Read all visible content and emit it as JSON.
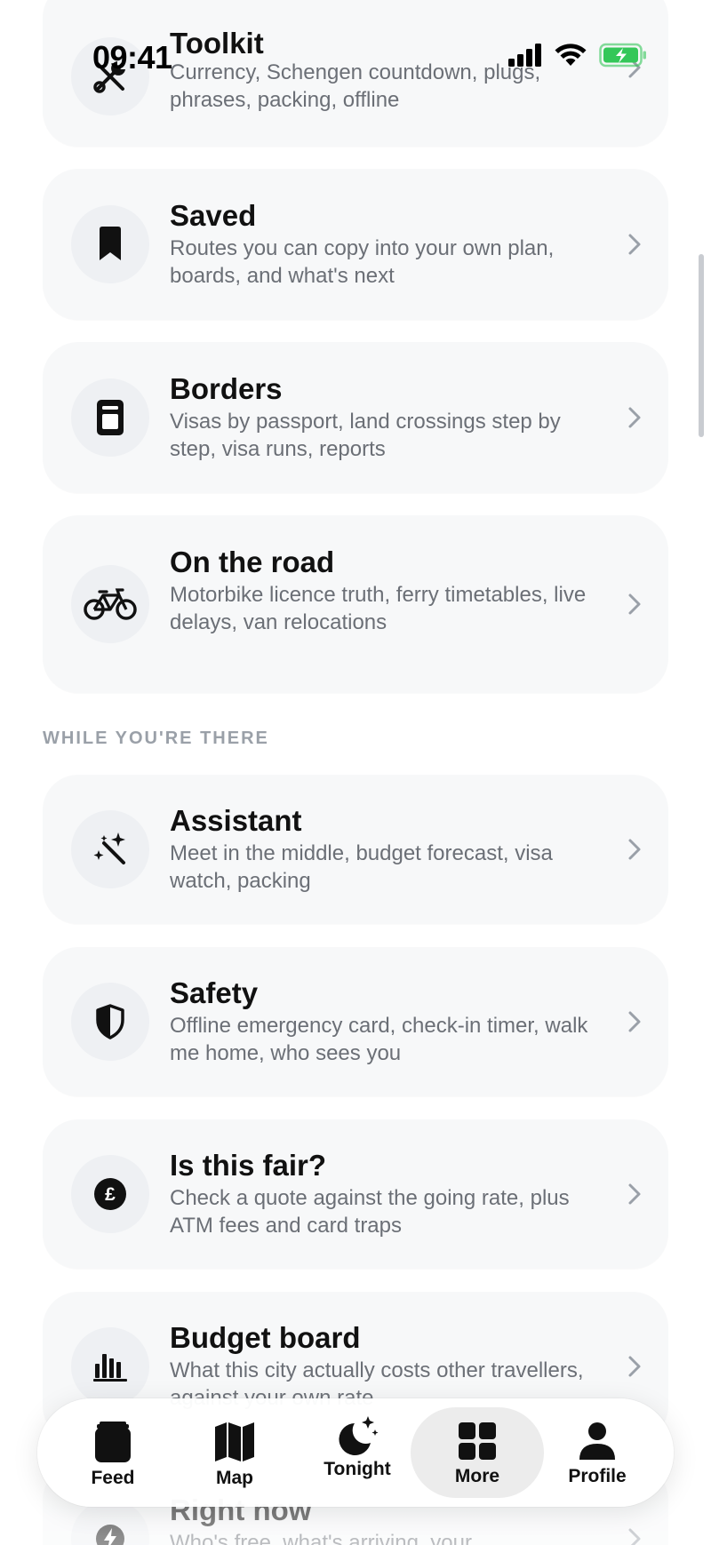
{
  "status_bar": {
    "time": "09:41",
    "signal_icon": "cellular-signal-icon",
    "wifi_icon": "wifi-icon",
    "battery_icon": "battery-charging-icon",
    "battery_color": "#34c759"
  },
  "cards_top": [
    {
      "title": "Toolkit",
      "desc": "Currency, Schengen countdown, plugs, phrases, packing, offline",
      "icon": "tools-icon"
    },
    {
      "title": "Saved",
      "desc": "Routes you can copy into your own plan, boards, and what's next",
      "icon": "bookmark-icon"
    },
    {
      "title": "Borders",
      "desc": "Visas by passport, land crossings step by step, visa runs, reports",
      "icon": "passport-icon"
    },
    {
      "title": "On the road",
      "desc": "Motorbike licence truth, ferry timetables, live delays, van relocations",
      "icon": "bicycle-icon"
    }
  ],
  "section": {
    "while_there_label": "WHILE YOU'RE THERE"
  },
  "cards_there": [
    {
      "title": "Assistant",
      "desc": "Meet in the middle, budget forecast, visa watch, packing",
      "icon": "magic-wand-icon"
    },
    {
      "title": "Safety",
      "desc": "Offline emergency card, check-in timer, walk me home, who sees you",
      "icon": "shield-icon"
    },
    {
      "title": "Is this fair?",
      "desc": "Check a quote against the going rate, plus ATM fees and card traps",
      "icon": "pound-coin-icon"
    },
    {
      "title": "Budget board",
      "desc": "What this city actually costs other travellers, against your own rate",
      "icon": "bar-chart-icon"
    },
    {
      "title": "Right now",
      "desc": "Who's free, what's arriving, your",
      "icon": "lightning-icon"
    }
  ],
  "tabbar": {
    "tabs": [
      {
        "label": "Feed",
        "icon": "feed-icon"
      },
      {
        "label": "Map",
        "icon": "map-icon"
      },
      {
        "label": "Tonight",
        "icon": "moon-stars-icon"
      },
      {
        "label": "More",
        "icon": "grid-icon",
        "active": true
      },
      {
        "label": "Profile",
        "icon": "person-icon"
      }
    ]
  }
}
